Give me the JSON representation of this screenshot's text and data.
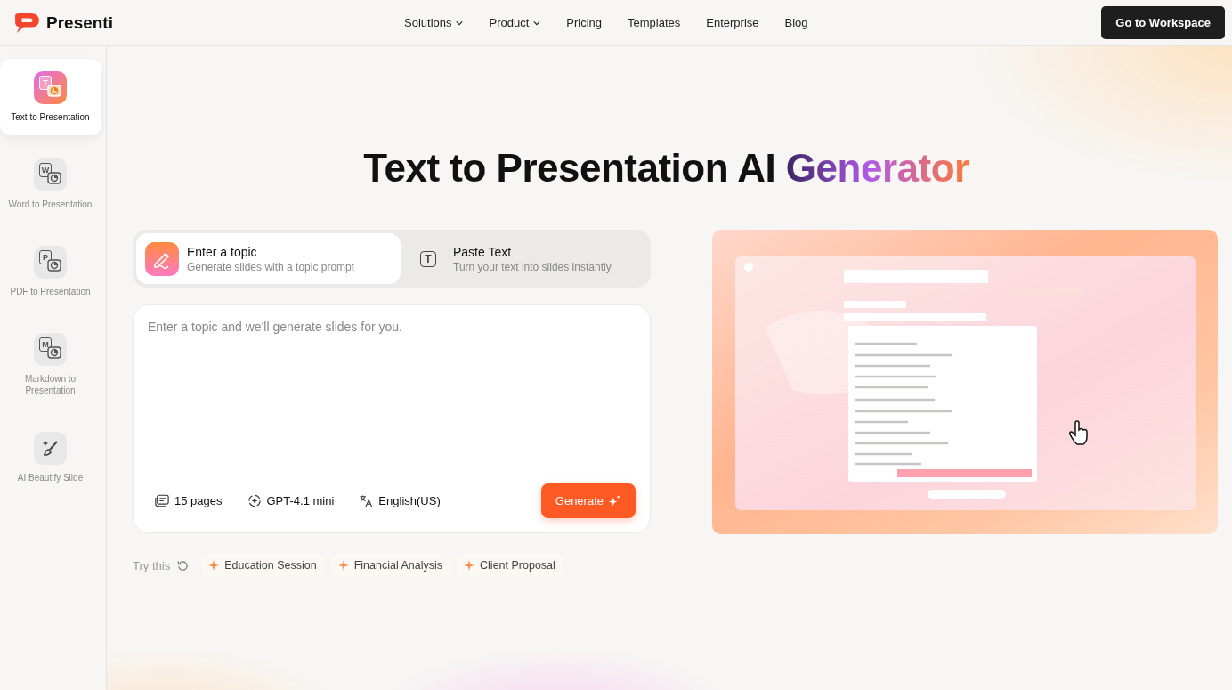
{
  "brand": {
    "name": "Presenti"
  },
  "nav": [
    {
      "label": "Solutions",
      "dropdown": true
    },
    {
      "label": "Product",
      "dropdown": true
    },
    {
      "label": "Pricing",
      "dropdown": false
    },
    {
      "label": "Templates",
      "dropdown": false
    },
    {
      "label": "Enterprise",
      "dropdown": false
    },
    {
      "label": "Blog",
      "dropdown": false
    }
  ],
  "workspace_button": "Go to Workspace",
  "sidebar": {
    "items": [
      {
        "kind": "convert",
        "icon_letter": "T",
        "label": "Text to Presentation",
        "selected": true
      },
      {
        "kind": "convert",
        "icon_letter": "W",
        "label": "Word to Presentation",
        "selected": false
      },
      {
        "kind": "convert",
        "icon_letter": "P",
        "label": "PDF to Presentation",
        "selected": false
      },
      {
        "kind": "convert",
        "icon_letter": "M",
        "label": "Markdown to Presentation",
        "selected": false
      },
      {
        "kind": "beautify",
        "label": "AI Beautify Slide",
        "selected": false
      }
    ]
  },
  "headline": {
    "text": "Text to Presentation AI",
    "highlight": "Generator"
  },
  "input_tabs": [
    {
      "kind": "topic",
      "title": "Enter a topic",
      "subtitle": "Generate slides with a topic prompt",
      "selected": true
    },
    {
      "kind": "paste",
      "icon_letter": "T",
      "title": "Paste Text",
      "subtitle": "Turn your text into slides instantly",
      "selected": false
    }
  ],
  "prompt": {
    "placeholder": "Enter a topic and we'll generate slides for you."
  },
  "options": [
    {
      "kind": "pages",
      "label": "15 pages"
    },
    {
      "kind": "model",
      "label": "GPT-4.1 mini"
    },
    {
      "kind": "language",
      "label": "English(US)"
    }
  ],
  "generate_button": "Generate",
  "suggestions": {
    "label": "Try this",
    "items": [
      "Education Session",
      "Financial Analysis",
      "Client Proposal"
    ]
  }
}
